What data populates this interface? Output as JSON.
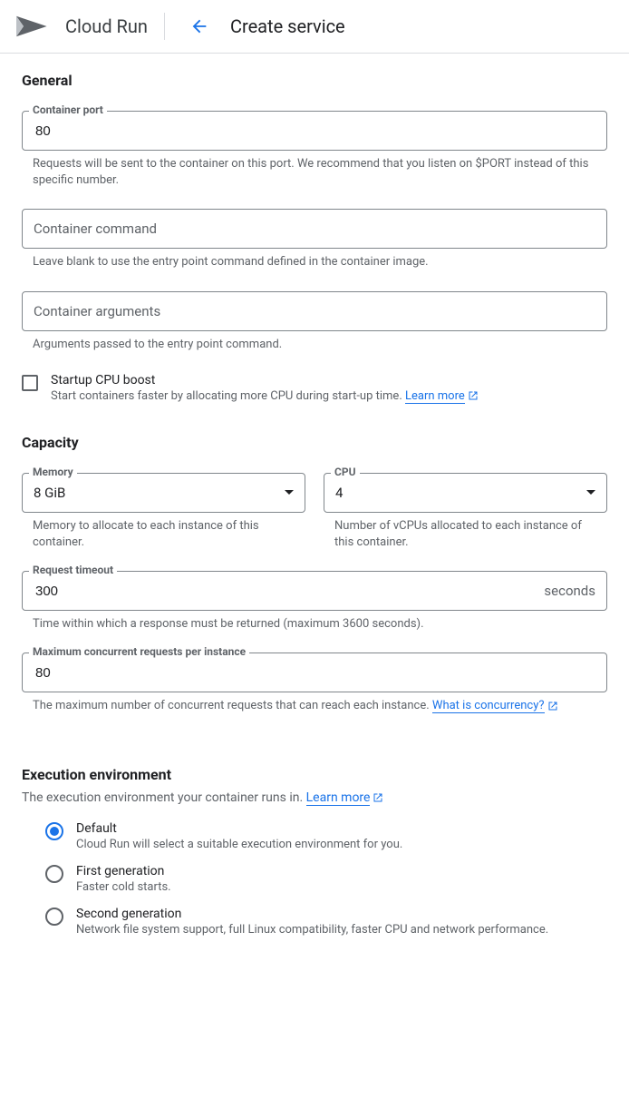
{
  "topbar": {
    "product": "Cloud Run",
    "page_title": "Create service"
  },
  "general": {
    "title": "General",
    "port": {
      "label": "Container port",
      "value": "80",
      "help": "Requests will be sent to the container on this port. We recommend that you listen on $PORT instead of this specific number."
    },
    "command": {
      "placeholder": "Container command",
      "help": "Leave blank to use the entry point command defined in the container image."
    },
    "args": {
      "placeholder": "Container arguments",
      "help": "Arguments passed to the entry point command."
    },
    "boost": {
      "label": "Startup CPU boost",
      "help": "Start containers faster by allocating more CPU during start-up time. ",
      "learn_more": "Learn more"
    }
  },
  "capacity": {
    "title": "Capacity",
    "memory": {
      "label": "Memory",
      "value": "8 GiB",
      "help": "Memory to allocate to each instance of this container."
    },
    "cpu": {
      "label": "CPU",
      "value": "4",
      "help": "Number of vCPUs allocated to each instance of this container."
    },
    "timeout": {
      "label": "Request timeout",
      "value": "300",
      "suffix": "seconds",
      "help": "Time within which a response must be returned (maximum 3600 seconds)."
    },
    "concurrency": {
      "label": "Maximum concurrent requests per instance",
      "value": "80",
      "help": "The maximum number of concurrent requests that can reach each instance. ",
      "link": "What is concurrency?"
    }
  },
  "exec_env": {
    "title": "Execution environment",
    "desc": "The execution environment your container runs in. ",
    "learn_more": "Learn more",
    "options": [
      {
        "label": "Default",
        "help": "Cloud Run will select a suitable execution environment for you.",
        "selected": true
      },
      {
        "label": "First generation",
        "help": "Faster cold starts.",
        "selected": false
      },
      {
        "label": "Second generation",
        "help": "Network file system support, full Linux compatibility, faster CPU and network performance.",
        "selected": false
      }
    ]
  }
}
